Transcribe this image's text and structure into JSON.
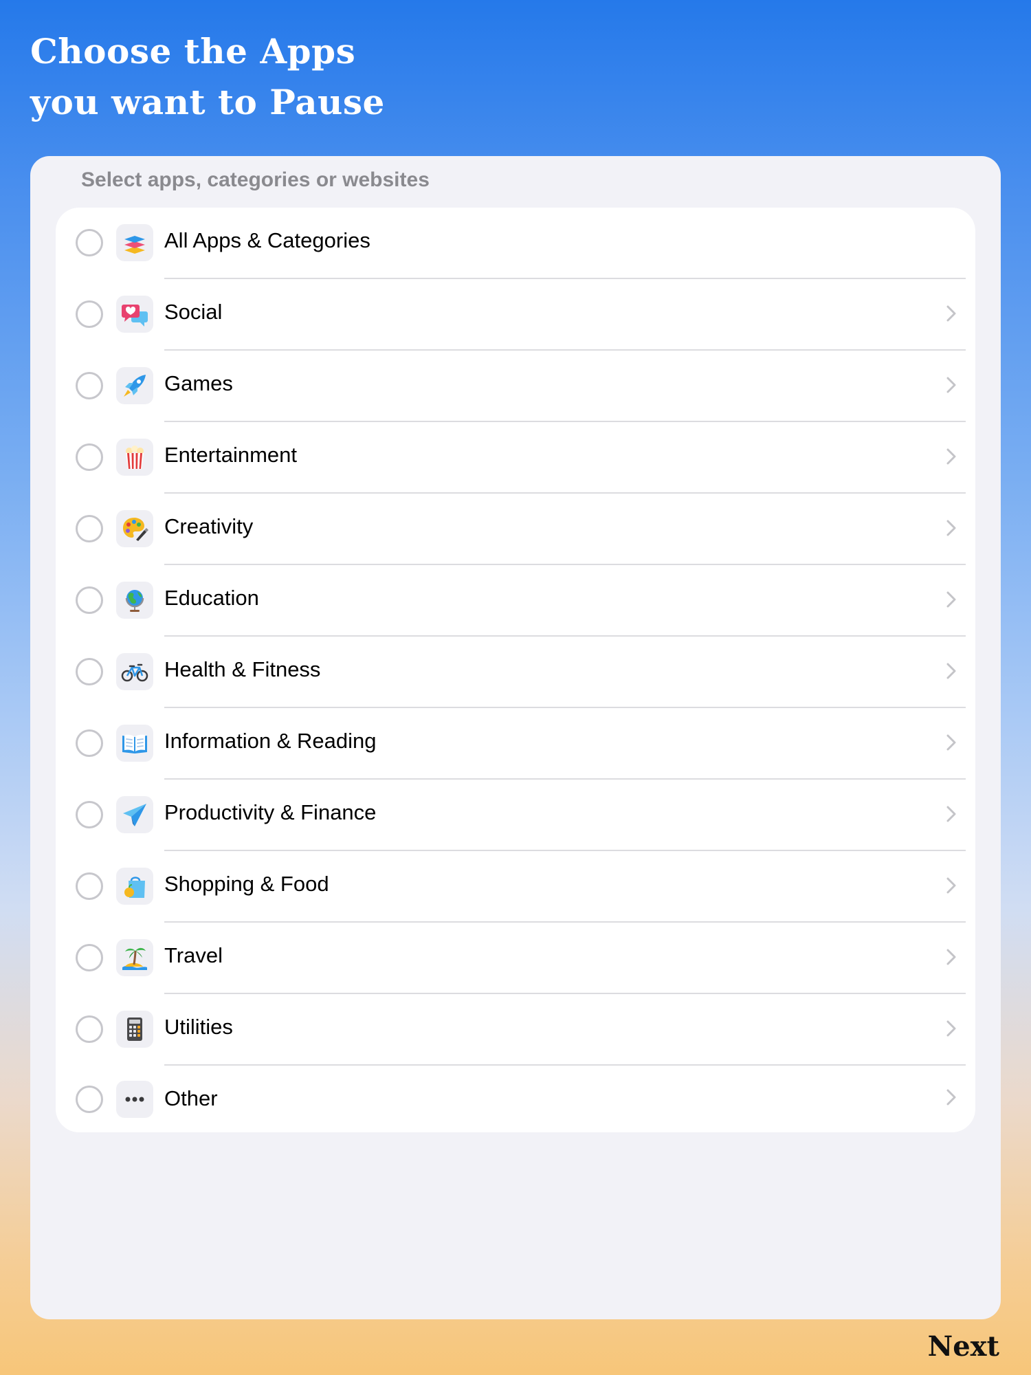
{
  "header": {
    "title_line1": "Choose the Apps",
    "title_line2": "you want to Pause"
  },
  "panel": {
    "subtitle": "Select apps, categories or websites"
  },
  "categories": [
    {
      "label": "All Apps & Categories",
      "icon": "stack-layers-icon",
      "has_chevron": false
    },
    {
      "label": "Social",
      "icon": "speech-bubble-heart-icon",
      "has_chevron": true
    },
    {
      "label": "Games",
      "icon": "rocket-icon",
      "has_chevron": true
    },
    {
      "label": "Entertainment",
      "icon": "popcorn-icon",
      "has_chevron": true
    },
    {
      "label": "Creativity",
      "icon": "palette-icon",
      "has_chevron": true
    },
    {
      "label": "Education",
      "icon": "globe-icon",
      "has_chevron": true
    },
    {
      "label": "Health & Fitness",
      "icon": "bicycle-icon",
      "has_chevron": true
    },
    {
      "label": "Information & Reading",
      "icon": "open-book-icon",
      "has_chevron": true
    },
    {
      "label": "Productivity & Finance",
      "icon": "paper-plane-icon",
      "has_chevron": true
    },
    {
      "label": "Shopping & Food",
      "icon": "shopping-bag-icon",
      "has_chevron": true
    },
    {
      "label": "Travel",
      "icon": "palm-island-icon",
      "has_chevron": true
    },
    {
      "label": "Utilities",
      "icon": "calculator-icon",
      "has_chevron": true
    },
    {
      "label": "Other",
      "icon": "ellipsis-icon",
      "has_chevron": true
    }
  ],
  "footer": {
    "next_label": "Next"
  },
  "colors": {
    "gradient_top": "#2579EA",
    "gradient_bottom": "#F7C679",
    "panel_bg": "#F2F2F7",
    "list_bg": "#FFFFFF",
    "separator": "#DCDCE0",
    "radio_border": "#C7C7CC",
    "chevron": "#C4C4C8"
  }
}
